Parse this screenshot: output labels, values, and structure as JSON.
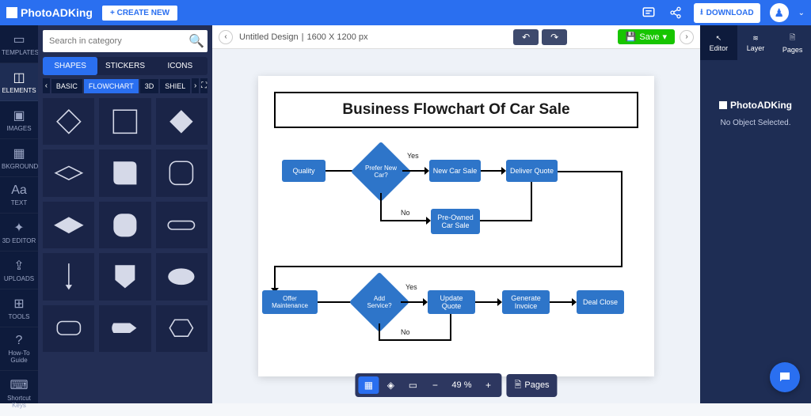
{
  "header": {
    "logo": "PhotoADKing",
    "create_label": "+ CREATE NEW",
    "download_label": "DOWNLOAD"
  },
  "rail": {
    "items": [
      {
        "label": "TEMPLATES",
        "icon": "▭"
      },
      {
        "label": "ELEMENTS",
        "icon": "◫"
      },
      {
        "label": "IMAGES",
        "icon": "▣"
      },
      {
        "label": "BKGROUND",
        "icon": "▦"
      },
      {
        "label": "TEXT",
        "icon": "Aa"
      },
      {
        "label": "3D EDITOR",
        "icon": "✦"
      },
      {
        "label": "UPLOADS",
        "icon": "⇪"
      },
      {
        "label": "TOOLS",
        "icon": "⊞"
      }
    ],
    "bottom": [
      {
        "label": "How-To Guide",
        "icon": "?"
      },
      {
        "label": "Shortcut Keys",
        "icon": "⌨"
      }
    ]
  },
  "panel": {
    "search_placeholder": "Search in category",
    "tabs": [
      "SHAPES",
      "STICKERS",
      "ICONS"
    ],
    "subtabs": [
      "BASIC",
      "FLOWCHART",
      "3D",
      "SHIEL"
    ]
  },
  "docbar": {
    "title": "Untitled Design",
    "dimensions": "1600 X 1200 px",
    "save_label": "Save"
  },
  "canvas": {
    "title": "Business Flowchart Of Car Sale",
    "nodes": {
      "quality": "Quality",
      "prefer": "Prefer New Car?",
      "newcar": "New Car Sale",
      "deliver": "Deliver Quote",
      "preowned": "Pre-Owned Car Sale",
      "offer": "Offer Maintenance",
      "addsvc": "Add Service?",
      "update": "Update Quote",
      "invoice": "Generate Invoice",
      "close": "Deal Close"
    },
    "labels": {
      "yes": "Yes",
      "no": "No"
    }
  },
  "bottombar": {
    "zoom": "49 %",
    "pages_label": "Pages"
  },
  "rightpanel": {
    "tabs": [
      "Editor",
      "Layer",
      "Pages"
    ],
    "logo": "PhotoADKing",
    "message": "No Object Selected."
  }
}
